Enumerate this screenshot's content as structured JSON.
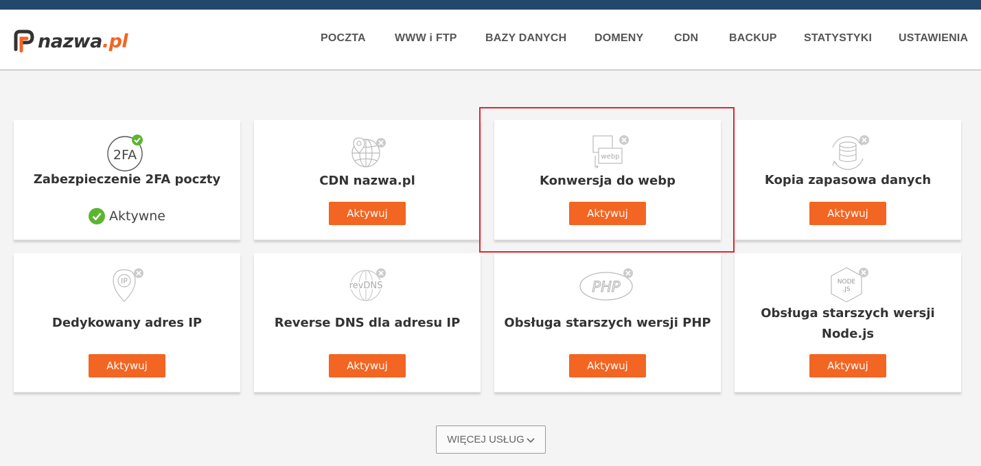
{
  "brand": {
    "logo_text_main": "nazwa",
    "logo_text_tld": ".pl"
  },
  "nav": {
    "items": [
      {
        "label": "POCZTA"
      },
      {
        "label": "WWW i FTP"
      },
      {
        "label": "BAZY DANYCH"
      },
      {
        "label": "DOMENY"
      },
      {
        "label": "CDN"
      },
      {
        "label": "BACKUP"
      },
      {
        "label": "STATYSTYKI"
      },
      {
        "label": "USTAWIENIA"
      }
    ]
  },
  "cards": [
    {
      "title": "Zabezpieczenie 2FA poczty",
      "icon": "2fa-icon",
      "icon_text": "2FA",
      "status": "Aktywne",
      "badge": "check"
    },
    {
      "title": "CDN nazwa.pl",
      "icon": "cdn-globe-icon",
      "button": "Aktywuj",
      "badge": "x"
    },
    {
      "title": "Konwersja do webp",
      "icon": "webp-convert-icon",
      "icon_text": "webp",
      "button": "Aktywuj",
      "badge": "x"
    },
    {
      "title": "Kopia zapasowa danych",
      "icon": "database-backup-icon",
      "button": "Aktywuj",
      "badge": "x"
    },
    {
      "title": "Dedykowany adres IP",
      "icon": "ip-pin-icon",
      "icon_text": "IP",
      "button": "Aktywuj",
      "badge": "x"
    },
    {
      "title": "Reverse DNS dla adresu IP",
      "icon": "revdns-globe-icon",
      "icon_text": "revDNS",
      "button": "Aktywuj",
      "badge": "x"
    },
    {
      "title": "Obsługa starszych wersji PHP",
      "icon": "php-icon",
      "icon_text": "PHP",
      "button": "Aktywuj",
      "badge": "x"
    },
    {
      "title": "Obsługa starszych wersji Node.js",
      "icon": "nodejs-icon",
      "icon_text_top": "NODE",
      "icon_text_bottom": ".JS",
      "button": "Aktywuj",
      "badge": "x"
    }
  ],
  "more": {
    "label": "WIĘCEJ USŁUG"
  },
  "colors": {
    "accent": "#f26522",
    "topbar": "#22486d",
    "success": "#5cb531",
    "highlight": "#e0242a"
  }
}
